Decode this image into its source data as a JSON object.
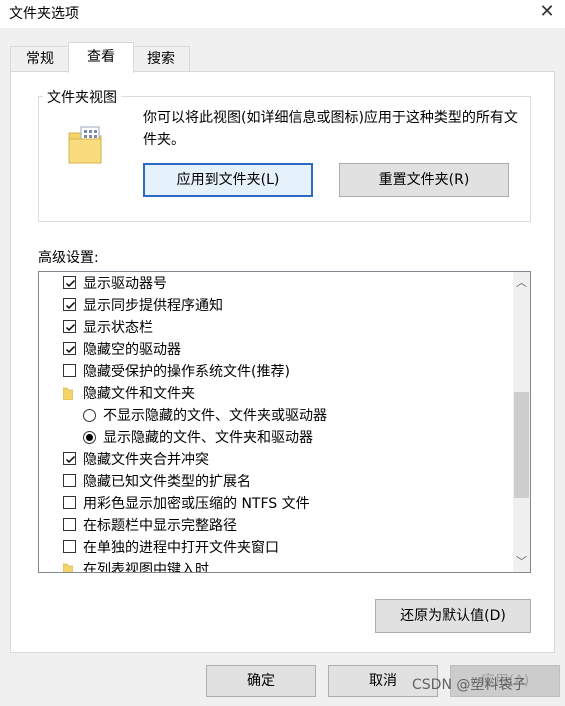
{
  "window": {
    "title": "文件夹选项"
  },
  "tabs": [
    {
      "label": "常规"
    },
    {
      "label": "查看"
    },
    {
      "label": "搜索"
    }
  ],
  "folder_views": {
    "legend": "文件夹视图",
    "description": "你可以将此视图(如详细信息或图标)应用于这种类型的所有文件夹。",
    "apply_button": "应用到文件夹(L)",
    "reset_button": "重置文件夹(R)"
  },
  "advanced": {
    "label": "高级设置:",
    "items": [
      {
        "type": "checkbox",
        "checked": true,
        "label": "显示驱动器号"
      },
      {
        "type": "checkbox",
        "checked": true,
        "label": "显示同步提供程序通知"
      },
      {
        "type": "checkbox",
        "checked": true,
        "label": "显示状态栏"
      },
      {
        "type": "checkbox",
        "checked": true,
        "label": "隐藏空的驱动器"
      },
      {
        "type": "checkbox",
        "checked": false,
        "label": "隐藏受保护的操作系统文件(推荐)"
      },
      {
        "type": "folder",
        "label": "隐藏文件和文件夹"
      },
      {
        "type": "radio",
        "checked": false,
        "label": "不显示隐藏的文件、文件夹或驱动器"
      },
      {
        "type": "radio",
        "checked": true,
        "label": "显示隐藏的文件、文件夹和驱动器"
      },
      {
        "type": "checkbox",
        "checked": true,
        "label": "隐藏文件夹合并冲突"
      },
      {
        "type": "checkbox",
        "checked": false,
        "label": "隐藏已知文件类型的扩展名"
      },
      {
        "type": "checkbox",
        "checked": false,
        "label": "用彩色显示加密或压缩的 NTFS 文件"
      },
      {
        "type": "checkbox",
        "checked": false,
        "label": "在标题栏中显示完整路径"
      },
      {
        "type": "checkbox",
        "checked": false,
        "label": "在单独的进程中打开文件夹窗口"
      },
      {
        "type": "folder",
        "label": "在列表视图中键入时"
      }
    ],
    "restore_button": "还原为默认值(D)"
  },
  "footer": {
    "ok": "确定",
    "cancel": "取消",
    "apply": "应用(A)"
  },
  "watermark": "CSDN @塑料袋子",
  "colors": {
    "accent_border": "#2d6ac6",
    "folder_yellow": "#f5d36b"
  }
}
